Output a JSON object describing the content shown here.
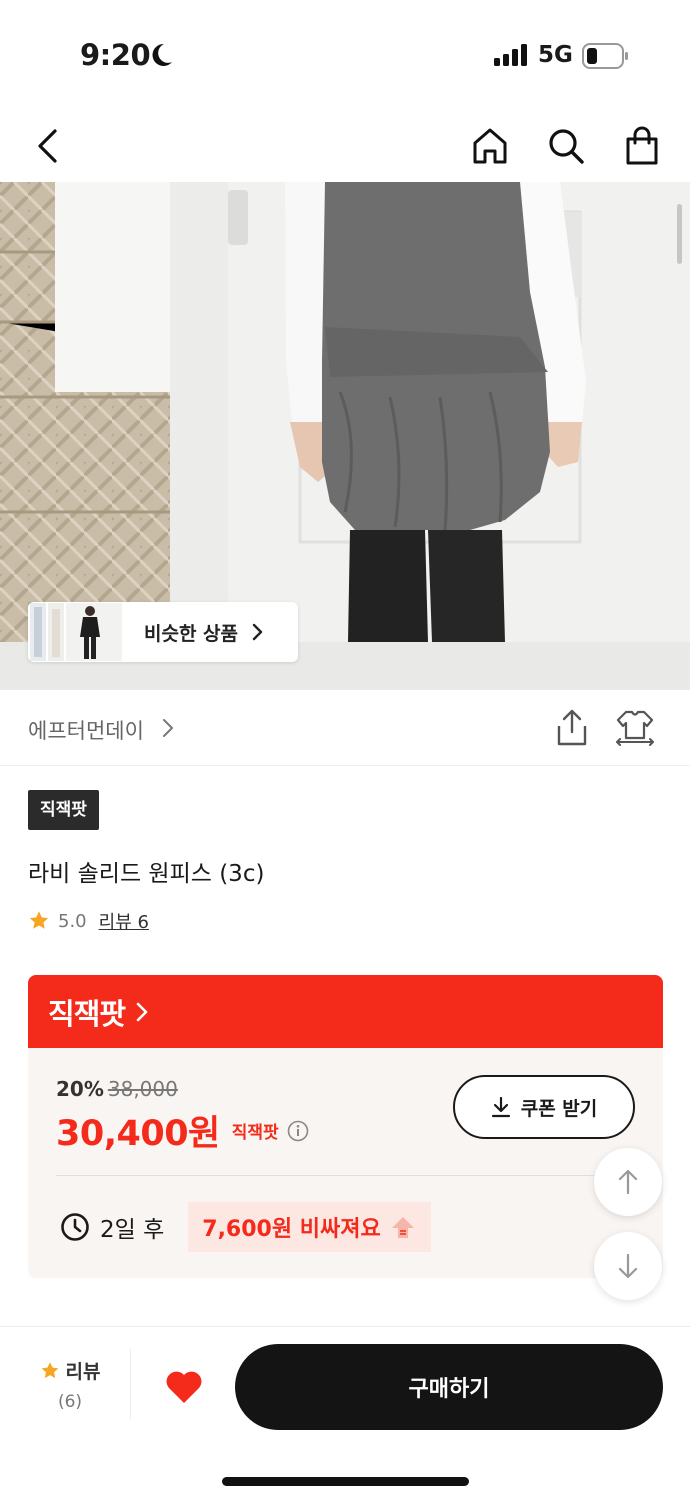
{
  "status_bar": {
    "time": "9:20",
    "network": "5G",
    "icons": [
      "moon-icon",
      "signal-icon",
      "battery-icon"
    ]
  },
  "nav": {
    "icons": [
      "back-icon",
      "home-icon",
      "search-icon",
      "cart-icon"
    ]
  },
  "hero": {
    "similar_label": "비슷한 상품"
  },
  "brand": {
    "name": "에프터먼데이",
    "icons": [
      "share-icon",
      "outfit-icon"
    ]
  },
  "product": {
    "badge": "직잭팟",
    "title": "라비 솔리드 원피스 (3c)",
    "rating": "5.0",
    "review_link": "리뷰 6"
  },
  "deal": {
    "header": "직잭팟",
    "discount_rate": "20%",
    "original_price": "38,000",
    "sale_price": "30,400원",
    "price_suffix": "직잭팟",
    "coupon_label": "쿠폰 받기",
    "timer_text": "2일 후",
    "price_up_text": "7,600원 비싸져요"
  },
  "bottom_bar": {
    "review_label": "리뷰",
    "review_count": "(6)",
    "buy_label": "구매하기"
  },
  "colors": {
    "accent_red": "#f42a1b",
    "star": "#f5a623",
    "dark": "#141414"
  }
}
